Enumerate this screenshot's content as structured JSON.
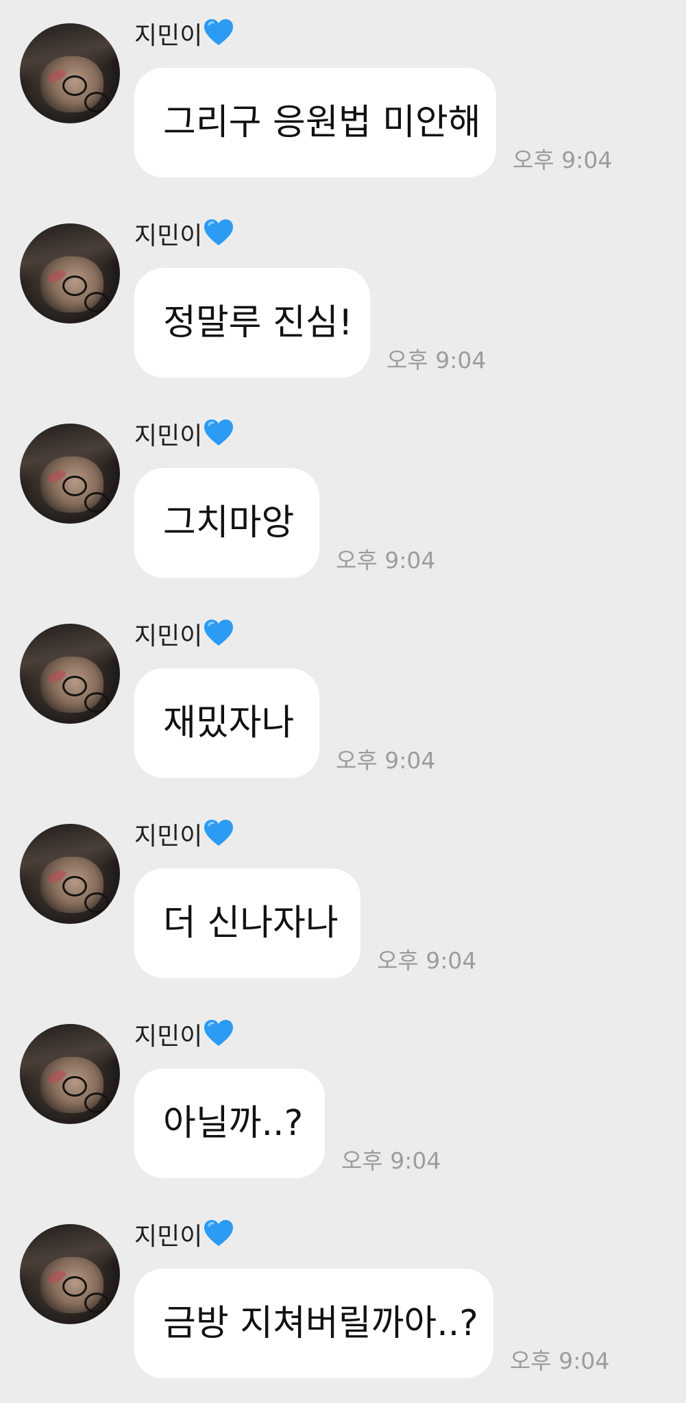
{
  "colors": {
    "background": "#ececec",
    "bubble": "#ffffff",
    "text": "#111111",
    "timestamp": "#9c9c9c",
    "heart": "#2b9bf4"
  },
  "sender": {
    "name": "지민이",
    "name_icon": "blue-heart-icon"
  },
  "messages": [
    {
      "text": "그리구 응원법 미안해",
      "time": "오후 9:04"
    },
    {
      "text": "정말루 진심!",
      "time": "오후 9:04"
    },
    {
      "text": "그치마앙",
      "time": "오후 9:04"
    },
    {
      "text": "재밌자나",
      "time": "오후 9:04"
    },
    {
      "text": "더 신나자나",
      "time": "오후 9:04"
    },
    {
      "text": "아닐까..?",
      "time": "오후 9:04"
    },
    {
      "text": "금방 지쳐버릴까아..?",
      "time": "오후 9:04"
    }
  ]
}
